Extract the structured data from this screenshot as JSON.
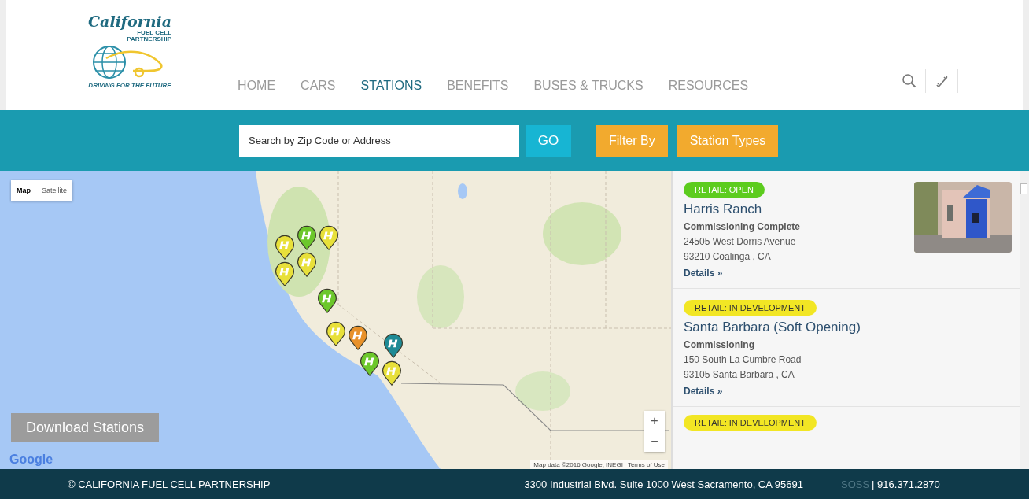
{
  "logo": {
    "title": "California",
    "subtitle": "FUEL CELL PARTNERSHIP",
    "tagline": "DRIVING FOR THE FUTURE"
  },
  "nav": [
    {
      "label": "HOME",
      "selected": false
    },
    {
      "label": "CARS",
      "selected": false
    },
    {
      "label": "STATIONS",
      "selected": true
    },
    {
      "label": "BENEFITS",
      "selected": false
    },
    {
      "label": "BUSES & TRUCKS",
      "selected": false
    },
    {
      "label": "RESOURCES",
      "selected": false
    }
  ],
  "search": {
    "placeholder": "Search by Zip Code or Address",
    "go": "GO"
  },
  "filters": [
    "Filter By",
    "Station Types"
  ],
  "map": {
    "types": [
      {
        "label": "Map",
        "selected": true
      },
      {
        "label": "Satellite",
        "selected": false
      }
    ],
    "download": "Download Stations",
    "attribution": "Google",
    "map_data": "Map data ©2016 Google, INEGI",
    "terms": "Terms of Use",
    "zoom_in": "+",
    "zoom_out": "−",
    "markers": [
      {
        "color": "#e8e03a"
      },
      {
        "color": "#6cc72b"
      },
      {
        "color": "#e8e03a"
      },
      {
        "color": "#e8e03a"
      },
      {
        "color": "#e8e03a"
      },
      {
        "color": "#6cc72b"
      },
      {
        "color": "#e8e03a"
      },
      {
        "color": "#e8912a"
      },
      {
        "color": "#6cc72b"
      },
      {
        "color": "#1e8a95"
      },
      {
        "color": "#e8e03a"
      }
    ]
  },
  "stations": [
    {
      "badge": "RETAIL: OPEN",
      "kind": "open",
      "name": "Harris Ranch",
      "status": "Commissioning Complete",
      "address": "24505 West Dorris Avenue",
      "city": "93210 Coalinga , CA",
      "details": "Details »"
    },
    {
      "badge": "RETAIL: IN DEVELOPMENT",
      "kind": "development",
      "name": "Santa Barbara (Soft Opening)",
      "status": "Commissioning",
      "address": "150 South La Cumbre Road",
      "city": "93105 Santa Barbara , CA",
      "details": "Details »"
    },
    {
      "badge": "RETAIL: IN DEVELOPMENT",
      "kind": "development"
    }
  ],
  "footer": {
    "copyright": "© CALIFORNIA FUEL CELL PARTNERSHIP",
    "address": "3300 Industrial Blvd. Suite 1000 West Sacramento, CA 95691",
    "soss": "SOSS",
    "phone": "| 916.371.2870"
  }
}
